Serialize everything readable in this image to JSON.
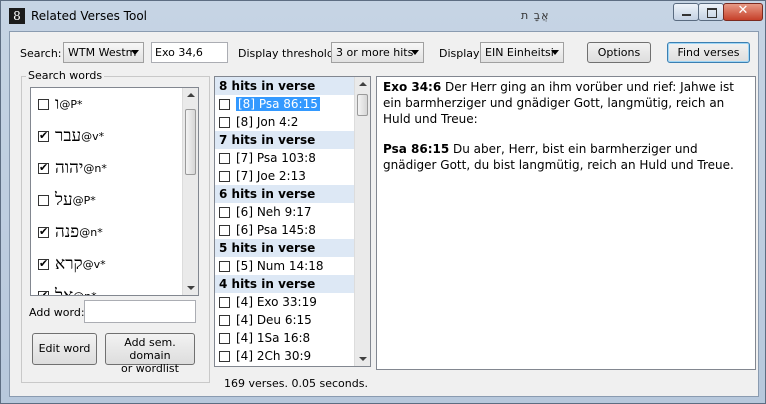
{
  "window": {
    "title": "Related Verses Tool",
    "title_extra": "אֲבָ ת"
  },
  "toolbar": {
    "search_label": "Search:",
    "search_source": "WTM Westm",
    "search_ref": "Exo 34,6",
    "threshold_label": "Display threshold:",
    "threshold_value": "3 or more hits",
    "display_label": "Display:",
    "display_value": "EIN Einheitsi",
    "options_label": "Options",
    "find_label": "Find verses"
  },
  "search_words": {
    "legend": "Search words",
    "items": [
      {
        "word": "ו",
        "suffix": "@P*",
        "checked": false
      },
      {
        "word": "עבר",
        "suffix": "@v*",
        "checked": true
      },
      {
        "word": "יהוה",
        "suffix": "@n*",
        "checked": true
      },
      {
        "word": "על",
        "suffix": "@P*",
        "checked": false
      },
      {
        "word": "פנה",
        "suffix": "@n*",
        "checked": true
      },
      {
        "word": "קרא",
        "suffix": "@v*",
        "checked": true
      },
      {
        "word": "אל",
        "suffix": "@n*",
        "checked": true
      }
    ],
    "add_word_label": "Add word:",
    "add_word_value": "",
    "edit_word_label": "Edit word",
    "add_sem_label_1": "Add sem. domain",
    "add_sem_label_2": "or wordlist"
  },
  "hits": {
    "groups": [
      {
        "header": "8 hits in verse",
        "rows": [
          {
            "text": "[8] Psa 86:15",
            "selected": true
          },
          {
            "text": "[8] Jon 4:2",
            "selected": false
          }
        ]
      },
      {
        "header": "7 hits in verse",
        "rows": [
          {
            "text": "[7] Psa 103:8",
            "selected": false
          },
          {
            "text": "[7] Joe 2:13",
            "selected": false
          }
        ]
      },
      {
        "header": "6 hits in verse",
        "rows": [
          {
            "text": "[6] Neh 9:17",
            "selected": false
          },
          {
            "text": "[6] Psa 145:8",
            "selected": false
          }
        ]
      },
      {
        "header": "5 hits in verse",
        "rows": [
          {
            "text": "[5] Num 14:18",
            "selected": false
          }
        ]
      },
      {
        "header": "4 hits in verse",
        "rows": [
          {
            "text": "[4] Exo 33:19",
            "selected": false
          },
          {
            "text": "[4] Deu 6:15",
            "selected": false
          },
          {
            "text": "[4] 1Sa 16:8",
            "selected": false
          },
          {
            "text": "[4] 2Ch 30:9",
            "selected": false
          }
        ]
      }
    ],
    "status": "169 verses. 0.05 seconds."
  },
  "verses": [
    {
      "ref": "Exo 34:6",
      "text": " Der Herr ging an ihm vorüber und rief: Jahwe ist ein barmherziger und gnädiger Gott, langmütig, reich an Huld und Treue:"
    },
    {
      "ref": "Psa 86:15",
      "text": " Du aber, Herr, bist ein barmherziger und gnädiger Gott, du bist langmütig, reich an Huld und Treue."
    }
  ]
}
